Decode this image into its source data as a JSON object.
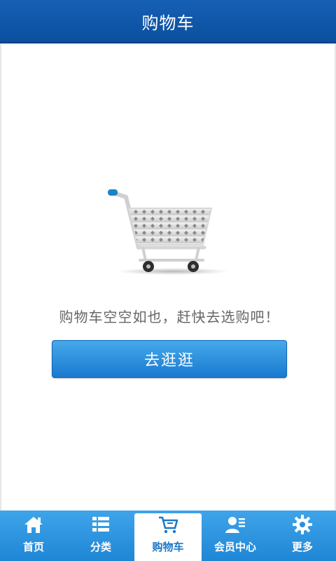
{
  "header": {
    "title": "购物车"
  },
  "main": {
    "empty_message": "购物车空空如也，赶快去选购吧！",
    "go_button_label": "去逛逛"
  },
  "tabbar": {
    "items": [
      {
        "label": "首页",
        "icon": "home-icon",
        "active": false
      },
      {
        "label": "分类",
        "icon": "list-icon",
        "active": false
      },
      {
        "label": "购物车",
        "icon": "cart-icon",
        "active": true
      },
      {
        "label": "会员中心",
        "icon": "user-icon",
        "active": false
      },
      {
        "label": "更多",
        "icon": "gear-icon",
        "active": false
      }
    ]
  },
  "colors": {
    "header_bg": "#0b4f9f",
    "button_bg": "#1a79d0",
    "tabbar_bg": "#2a90df",
    "text_muted": "#666666"
  }
}
